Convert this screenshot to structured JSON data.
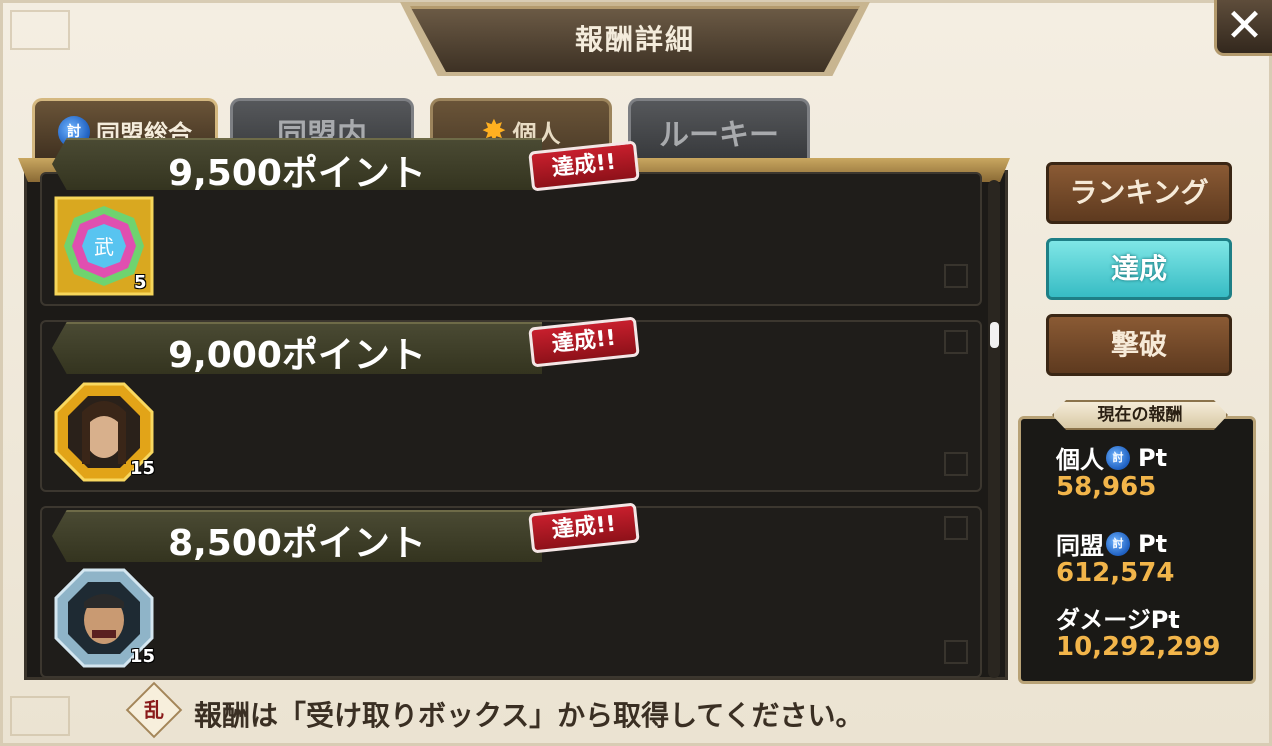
{
  "header": {
    "title": "報酬詳細",
    "close_label": "✕"
  },
  "tabs": [
    {
      "label": "同盟総合",
      "icon": "blue-seal-icon",
      "icon_glyph": "討",
      "active": true
    },
    {
      "label": "同盟内",
      "active": false
    },
    {
      "label": "個人",
      "icon": "star-burst-icon",
      "icon_glyph": "✸",
      "active": false
    },
    {
      "label": "ルーキー",
      "active": false
    }
  ],
  "rewards": [
    {
      "points": "9,500ポイント",
      "badge": "達成!!",
      "icon": "rainbow-gem-icon",
      "count": "5"
    },
    {
      "points": "9,000ポイント",
      "badge": "達成!!",
      "icon": "gold-frame-portrait-icon",
      "count": "15"
    },
    {
      "points": "8,500ポイント",
      "badge": "達成!!",
      "icon": "silver-frame-portrait-icon",
      "count": "15"
    }
  ],
  "side_buttons": {
    "ranking": "ランキング",
    "achievement": "達成",
    "defeat": "撃破"
  },
  "current_reward": {
    "title": "現在の報酬",
    "personal_label": "個人",
    "personal_suffix": "Pt",
    "personal_value": "58,965",
    "alliance_label": "同盟",
    "alliance_suffix": "Pt",
    "alliance_value": "612,574",
    "damage_label": "ダメージPt",
    "damage_value": "10,292,299",
    "icon_glyph": "討"
  },
  "footer": {
    "icon_glyph": "乱",
    "text": "報酬は「受け取りボックス」から取得してください。"
  },
  "colors": {
    "accent_gold": "#f2b54a",
    "badge_red": "#c71f2d",
    "cyan_button": "#37bcc4"
  }
}
